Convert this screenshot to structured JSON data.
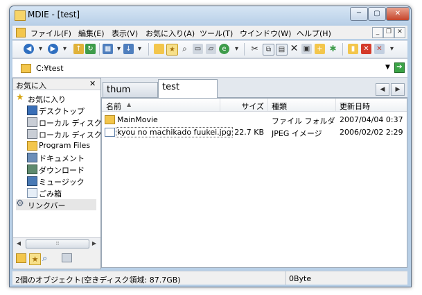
{
  "window": {
    "title": "MDIE - [test]"
  },
  "menu": [
    "ファイル(F)",
    "編集(E)",
    "表示(V)",
    "お気に入り(A)",
    "ツール(T)",
    "ウインドウ(W)",
    "ヘルプ(H)"
  ],
  "address": {
    "path": "C:¥test"
  },
  "sidebar": {
    "title": "お気に入",
    "items": [
      {
        "label": "お気に入り",
        "icon": "star-icon",
        "indent": 0
      },
      {
        "label": "デスクトップ",
        "icon": "desktop-icon",
        "indent": 1
      },
      {
        "label": "ローカル ディスク",
        "icon": "drive-icon",
        "indent": 1
      },
      {
        "label": "ローカル ディスク",
        "icon": "drive-icon",
        "indent": 1
      },
      {
        "label": "Program Files",
        "icon": "folder-icon",
        "indent": 1
      },
      {
        "label": "ドキュメント",
        "icon": "documents-icon",
        "indent": 1
      },
      {
        "label": "ダウンロード",
        "icon": "download-icon",
        "indent": 1
      },
      {
        "label": "ミュージック",
        "icon": "music-icon",
        "indent": 1
      },
      {
        "label": "ごみ箱",
        "icon": "recycle-bin-icon",
        "indent": 1
      },
      {
        "label": "リンクバー",
        "icon": "gear-icon",
        "indent": 0
      }
    ]
  },
  "tabs": [
    {
      "label": "thum",
      "active": false
    },
    {
      "label": "test",
      "active": true
    }
  ],
  "list": {
    "columns": [
      "名前",
      "サイズ",
      "種類",
      "更新日時"
    ],
    "rows": [
      {
        "name": "MainMovie",
        "size": "",
        "type": "ファイル フォルダ",
        "date": "2007/04/04 0:37",
        "icon": "folder-icon"
      },
      {
        "name": "kyou no machikado fuukei.jpg",
        "size": "22.7 KB",
        "type": "JPEG イメージ",
        "date": "2006/02/02 2:29",
        "icon": "image-file-icon"
      }
    ]
  },
  "status": {
    "objects": "2個のオブジェクト(空きディスク領域: 87.7GB)",
    "size": "0Byte"
  },
  "colors": {
    "accent": "#316ac5",
    "folder": "#f3c64c",
    "titlebar": "#b9d0e8"
  }
}
